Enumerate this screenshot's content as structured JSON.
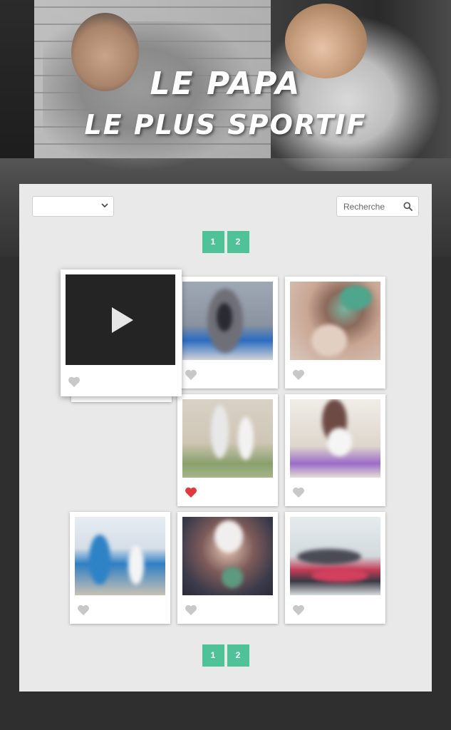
{
  "hero": {
    "title_line1": "Le Papa",
    "title_line2": "Le Plus Sportif"
  },
  "filter": {
    "selected": ""
  },
  "search": {
    "placeholder": "Recherche",
    "icon": "search-icon"
  },
  "pagination": {
    "pages": [
      "1",
      "2"
    ]
  },
  "gallery": {
    "items": [
      {
        "type": "video",
        "liked": false,
        "icon": "play-icon"
      },
      {
        "type": "photo",
        "liked": false
      },
      {
        "type": "photo",
        "liked": false
      },
      {
        "type": "photo",
        "liked": false
      },
      {
        "type": "photo",
        "liked": true
      },
      {
        "type": "photo",
        "liked": false
      },
      {
        "type": "photo",
        "liked": false
      },
      {
        "type": "photo",
        "liked": false
      },
      {
        "type": "photo",
        "liked": false
      }
    ]
  },
  "colors": {
    "accent": "#4fc397",
    "heart_liked": "#e0393e",
    "heart_default": "#c8c8c8",
    "page_bg": "#2f2f2f",
    "panel_bg": "#e9e9e9"
  }
}
